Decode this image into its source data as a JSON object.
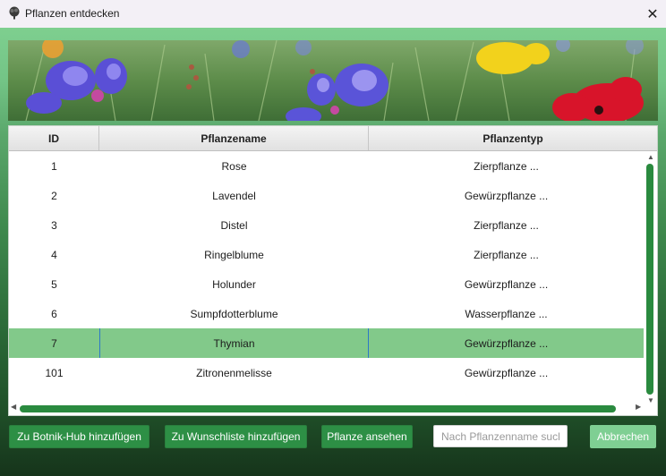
{
  "window": {
    "title": "Pflanzen entdecken",
    "close_glyph": "✕"
  },
  "table": {
    "columns": [
      "ID",
      "Pflanzename",
      "Pflanzentyp"
    ],
    "rows": [
      {
        "id": "1",
        "name": "Rose",
        "type": "Zierpflanze ..."
      },
      {
        "id": "2",
        "name": "Lavendel",
        "type": "Gewürzpflanze ..."
      },
      {
        "id": "3",
        "name": "Distel",
        "type": "Zierpflanze ..."
      },
      {
        "id": "4",
        "name": "Ringelblume",
        "type": "Zierpflanze ..."
      },
      {
        "id": "5",
        "name": "Holunder",
        "type": "Gewürzpflanze ..."
      },
      {
        "id": "6",
        "name": "Sumpfdotterblume",
        "type": "Wasserpflanze ..."
      },
      {
        "id": "7",
        "name": "Thymian",
        "type": "Gewürzpflanze ...",
        "selected": true
      },
      {
        "id": "101",
        "name": "Zitronenmelisse",
        "type": "Gewürzpflanze ..."
      }
    ]
  },
  "actions": {
    "add_botnik_hub": "Zu Botnik-Hub hinzufügen",
    "add_wishlist": "Zu Wunschliste hinzufügen",
    "view_plant": "Pflanze ansehen",
    "search_placeholder": "Nach Pflanzenname suchen",
    "cancel": "Abbrechen"
  },
  "colors": {
    "accent": "#2d8f45",
    "selected_row": "#82c98a",
    "cancel_button": "#7fcf93"
  },
  "icons": [
    "tree-app-icon",
    "close-icon",
    "scroll-up-icon",
    "scroll-down-icon",
    "scroll-left-icon",
    "scroll-right-icon"
  ]
}
